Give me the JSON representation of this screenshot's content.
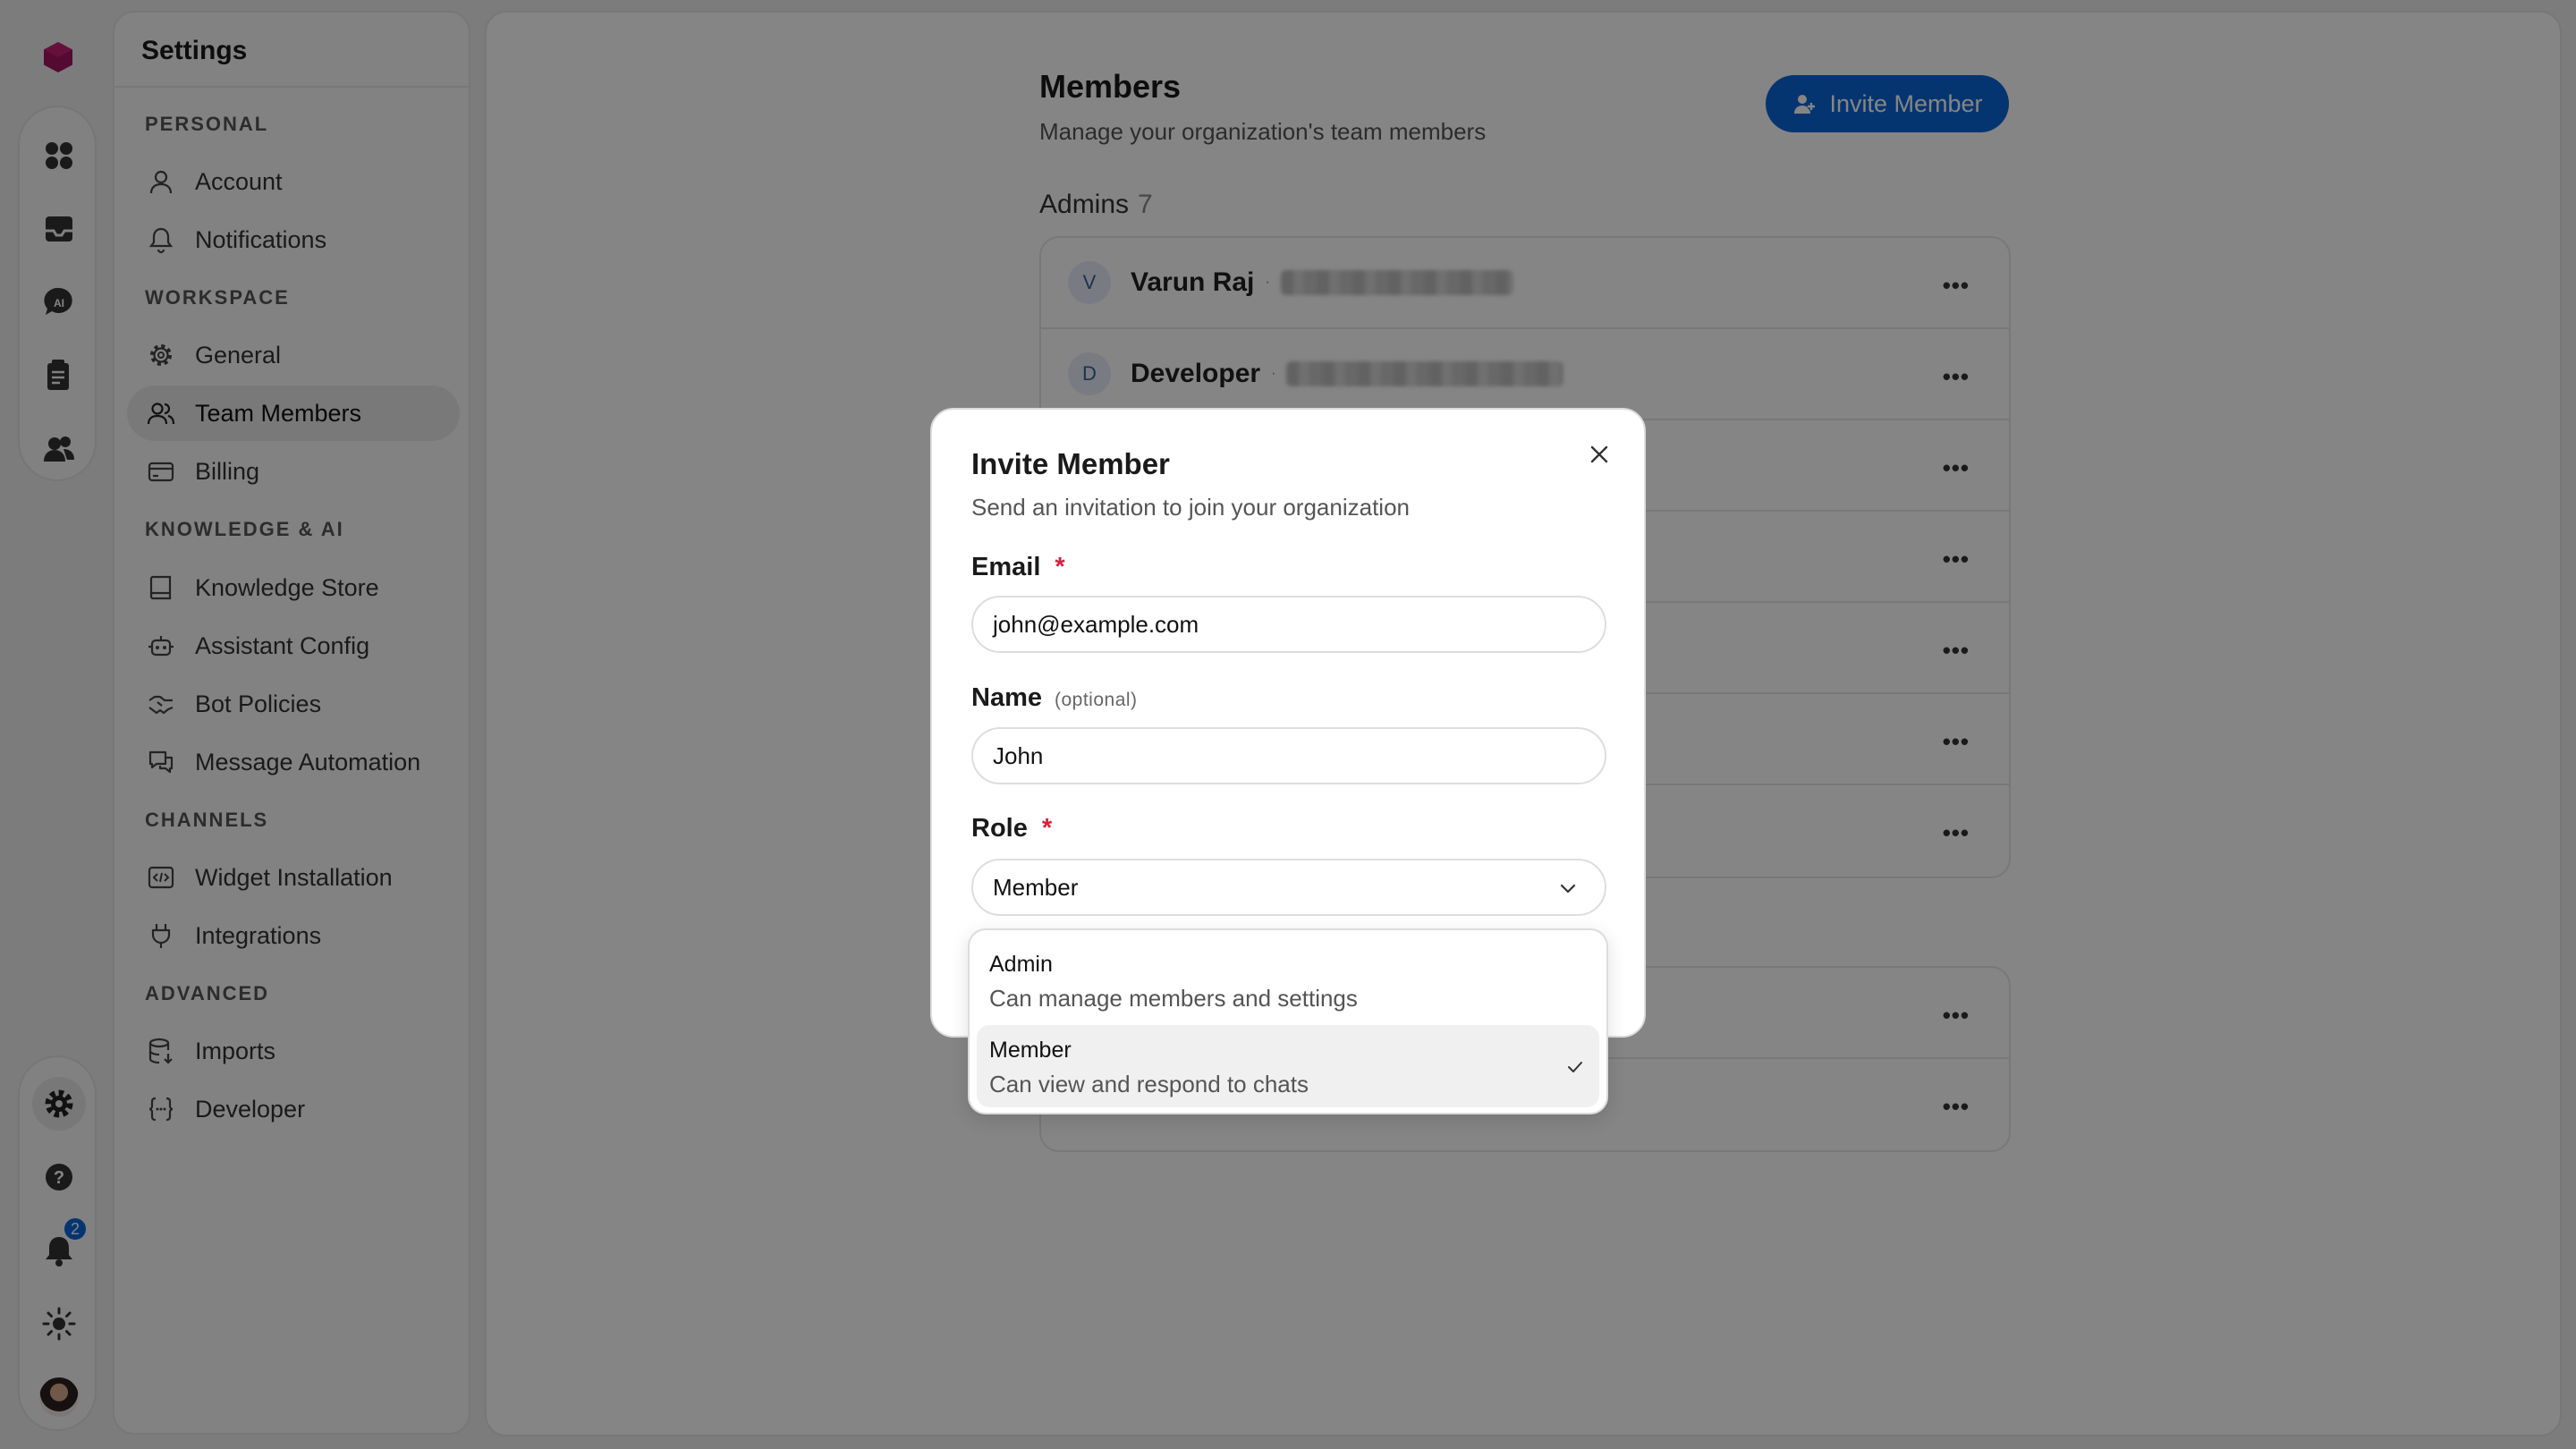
{
  "sidebar": {
    "title": "Settings",
    "sections": [
      {
        "label": "PERSONAL",
        "items": [
          {
            "label": "Account"
          },
          {
            "label": "Notifications"
          }
        ]
      },
      {
        "label": "WORKSPACE",
        "items": [
          {
            "label": "General"
          },
          {
            "label": "Team Members"
          },
          {
            "label": "Billing"
          }
        ]
      },
      {
        "label": "KNOWLEDGE & AI",
        "items": [
          {
            "label": "Knowledge Store"
          },
          {
            "label": "Assistant Config"
          },
          {
            "label": "Bot Policies"
          },
          {
            "label": "Message Automation"
          }
        ]
      },
      {
        "label": "CHANNELS",
        "items": [
          {
            "label": "Widget Installation"
          },
          {
            "label": "Integrations"
          }
        ]
      },
      {
        "label": "ADVANCED",
        "items": [
          {
            "label": "Imports"
          },
          {
            "label": "Developer"
          }
        ]
      }
    ]
  },
  "rail": {
    "notification_count": "2"
  },
  "main": {
    "title": "Members",
    "subtitle": "Manage your organization's team members",
    "invite_label": "Invite Member",
    "admins_label": "Admins",
    "admins_count": "7",
    "rows": [
      {
        "initial": "V",
        "name": "Varun Raj"
      },
      {
        "initial": "D",
        "name": "Developer"
      }
    ]
  },
  "dialog": {
    "title": "Invite Member",
    "subtitle": "Send an invitation to join your organization",
    "email_label": "Email",
    "required_mark": "*",
    "email_value": "john@example.com",
    "name_label": "Name",
    "name_optional": "(optional)",
    "name_value": "John",
    "role_label": "Role",
    "role_value": "Member",
    "options": [
      {
        "label": "Admin",
        "desc": "Can manage members and settings"
      },
      {
        "label": "Member",
        "desc": "Can view and respond to chats"
      }
    ]
  },
  "colors": {
    "accent": "#0a66d8",
    "required": "#d8213b",
    "logo": "#a3155e"
  }
}
